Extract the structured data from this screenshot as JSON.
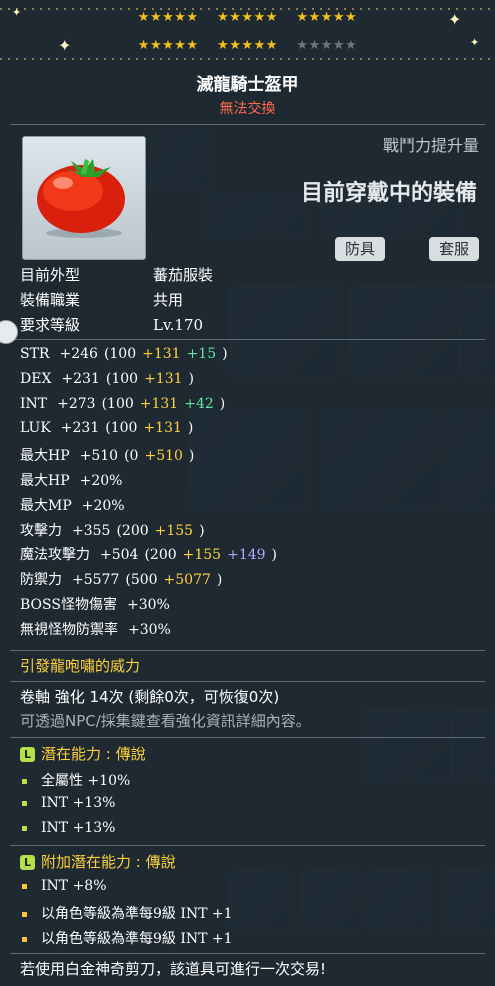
{
  "stars": {
    "row1": [
      "★★★★★",
      "★★★★★",
      "★★★★★"
    ],
    "row2_on": [
      "★★★★★",
      "★★★★★"
    ],
    "row2_off": "★★★★★"
  },
  "item": {
    "name": "滅龍騎士盔甲",
    "trade_status": "無法交換"
  },
  "combat": {
    "label": "戰鬥力提升量",
    "wearing": "目前穿戴中的裝備"
  },
  "tags": [
    "防具",
    "套服"
  ],
  "info": [
    {
      "key": "目前外型",
      "value": "蕃茄服裝"
    },
    {
      "key": "裝備職業",
      "value": "共用"
    },
    {
      "key": "要求等級",
      "value": "Lv.170"
    }
  ],
  "stats": [
    {
      "label": "STR",
      "total": "+246",
      "base": "(100",
      "yellow": "+131",
      "green": "+15",
      "violet": "",
      "close": ")"
    },
    {
      "label": "DEX",
      "total": "+231",
      "base": "(100",
      "yellow": "+131",
      "green": "",
      "violet": "",
      "close": ")"
    },
    {
      "label": "INT",
      "total": "+273",
      "base": "(100",
      "yellow": "+131",
      "green": "+42",
      "violet": "",
      "close": ")"
    },
    {
      "label": "LUK",
      "total": "+231",
      "base": "(100",
      "yellow": "+131",
      "green": "",
      "violet": "",
      "close": ")"
    },
    {
      "label": "最大HP",
      "total": "+510",
      "base": "(0",
      "yellow": "+510",
      "green": "",
      "violet": "",
      "close": ")"
    },
    {
      "label": "最大HP",
      "total": "+20%",
      "base": "",
      "yellow": "",
      "green": "",
      "violet": "",
      "close": ""
    },
    {
      "label": "最大MP",
      "total": "+20%",
      "base": "",
      "yellow": "",
      "green": "",
      "violet": "",
      "close": ""
    },
    {
      "label": "攻擊力",
      "total": "+355",
      "base": "(200",
      "yellow": "+155",
      "green": "",
      "violet": "",
      "close": ")"
    },
    {
      "label": "魔法攻擊力",
      "total": "+504",
      "base": "(200",
      "yellow": "+155",
      "green": "",
      "violet": "+149",
      "close": ")"
    },
    {
      "label": "防禦力",
      "total": "+5577",
      "base": "(500",
      "yellow": "+5077",
      "green": "",
      "violet": "",
      "close": ")"
    },
    {
      "label": "BOSS怪物傷害",
      "total": "+30%",
      "base": "",
      "yellow": "",
      "green": "",
      "violet": "",
      "close": ""
    },
    {
      "label": "無視怪物防禦率",
      "total": "+30%",
      "base": "",
      "yellow": "",
      "green": "",
      "violet": "",
      "close": ""
    }
  ],
  "special": "引發龍咆嘯的威力",
  "scroll": "卷軸 強化 14次 (剩餘0次，可恢復0次)",
  "hint": "可透過NPC/採集鍵查看強化資訊詳細內容。",
  "potential": {
    "badge": "L",
    "title": "潛在能力 : 傳說",
    "lines": [
      "全屬性 +10%",
      "INT +13%",
      "INT +13%"
    ]
  },
  "additional": {
    "badge": "L",
    "title": "附加潛在能力 : 傳說",
    "lines": [
      "INT +8%",
      "以角色等級為準每9級 INT +1",
      "以角色等級為準每9級 INT +1"
    ]
  },
  "footer": "若使用白金神奇剪刀，該道具可進行一次交易!"
}
